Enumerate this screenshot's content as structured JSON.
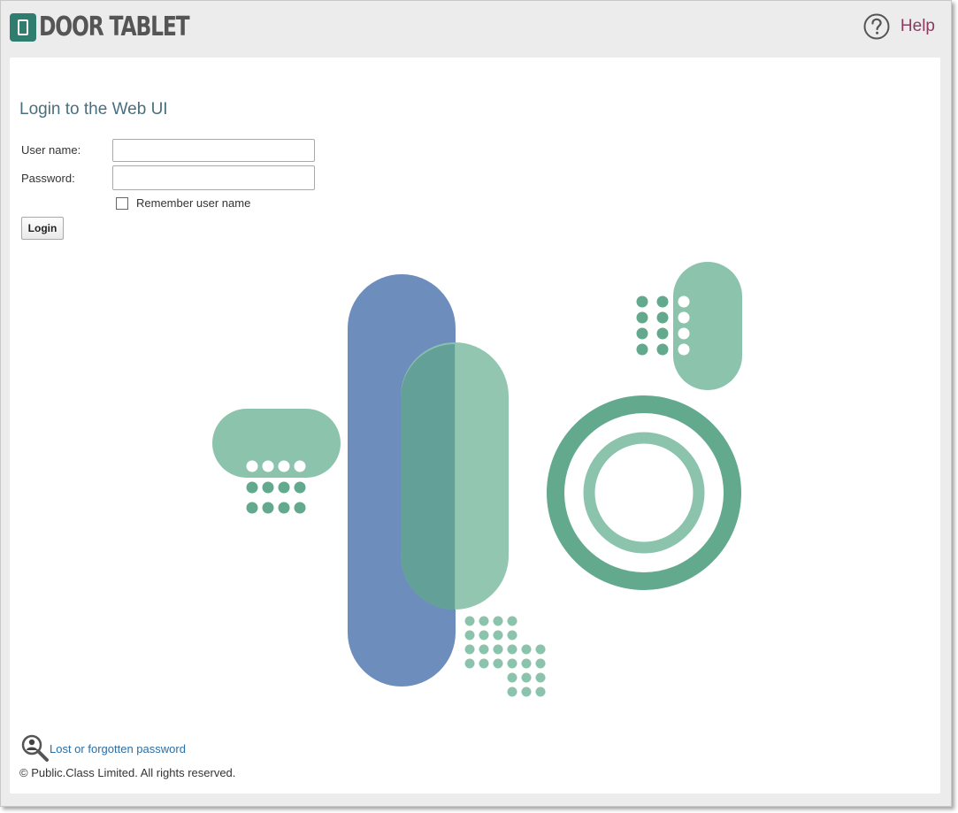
{
  "header": {
    "brand": "DOOR TABLET",
    "help_label": "Help"
  },
  "login": {
    "title": "Login to the Web UI",
    "username_label": "User name:",
    "username_value": "",
    "password_label": "Password:",
    "password_value": "",
    "remember_label": "Remember user name",
    "remember_checked": false,
    "login_button": "Login"
  },
  "footer": {
    "forgot_link": "Lost or forgotten password",
    "copyright": "© Public.Class Limited.  All rights reserved."
  },
  "colors": {
    "brand_teal": "#2e7d6e",
    "help": "#8b3a62",
    "link": "#2a6ea6",
    "art_blue": "#6d8dbd",
    "art_green_light": "#8cc3ad",
    "art_green_dark": "#62a98d"
  },
  "icons": {
    "help": "question-circle-icon",
    "forgot": "magnifier-user-icon",
    "logo": "tablet-logo-icon"
  }
}
